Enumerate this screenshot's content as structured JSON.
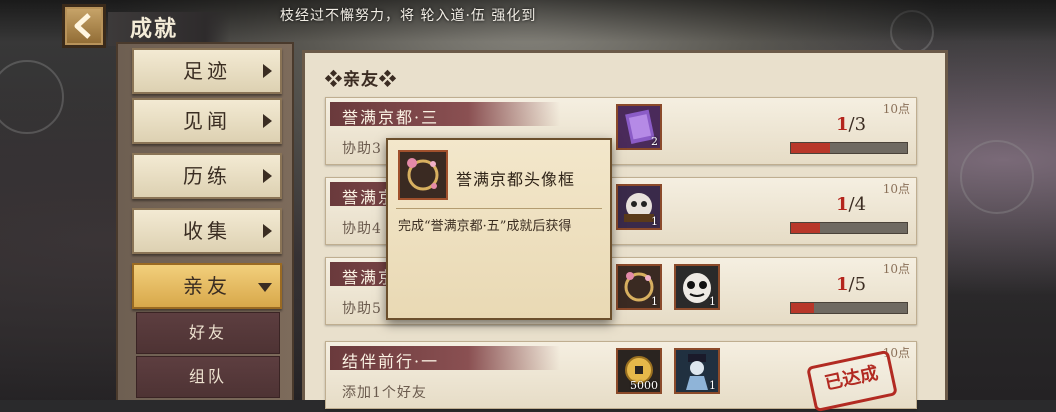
{
  "header": {
    "back_icon": "chevron-left-icon",
    "title": "成就",
    "marquee": "枝经过不懈努力，将 轮入道·伍 强化到"
  },
  "sidebar": {
    "items": [
      {
        "label": "足迹"
      },
      {
        "label": "见闻"
      },
      {
        "label": "历练"
      },
      {
        "label": "收集"
      },
      {
        "label": "亲友"
      }
    ],
    "subitems": [
      {
        "label": "好友"
      },
      {
        "label": "组队"
      }
    ]
  },
  "main": {
    "section_title": "❖亲友❖",
    "cards": [
      {
        "title": "誉满京都·三",
        "desc": "协助3",
        "points": "10点",
        "rewards": [
          {
            "icon": "purple-card-icon",
            "count": "2"
          }
        ],
        "progress": {
          "current": "1",
          "total": "/3",
          "fraction": 0.333
        }
      },
      {
        "title": "誉满京",
        "desc": "协助4",
        "points": "10点",
        "rewards": [
          {
            "icon": "material-daruma-icon",
            "count": "1"
          }
        ],
        "progress": {
          "current": "1",
          "total": "/4",
          "fraction": 0.25
        }
      },
      {
        "title": "誉满京",
        "desc": "协助5",
        "points": "10点",
        "rewards": [
          {
            "icon": "avatar-frame-icon",
            "count": "1"
          },
          {
            "icon": "daruma-icon",
            "count": "1"
          }
        ],
        "progress": {
          "current": "1",
          "total": "/5",
          "fraction": 0.2
        }
      },
      {
        "title": "结伴前行·一",
        "desc": "添加1个好友",
        "points": "10点",
        "rewards": [
          {
            "icon": "gold-coin-icon",
            "count": "5000"
          },
          {
            "icon": "shikigami-icon",
            "count": "1"
          }
        ],
        "stamp": "已达成"
      }
    ]
  },
  "tooltip": {
    "icon": "avatar-frame-icon",
    "title": "誉满京都头像框",
    "desc": "完成“誉满京都·五”成就后获得"
  },
  "colors": {
    "accent_red": "#b4241c",
    "panel": "#e9e0cc",
    "active_tab": "#f2cf7c"
  }
}
